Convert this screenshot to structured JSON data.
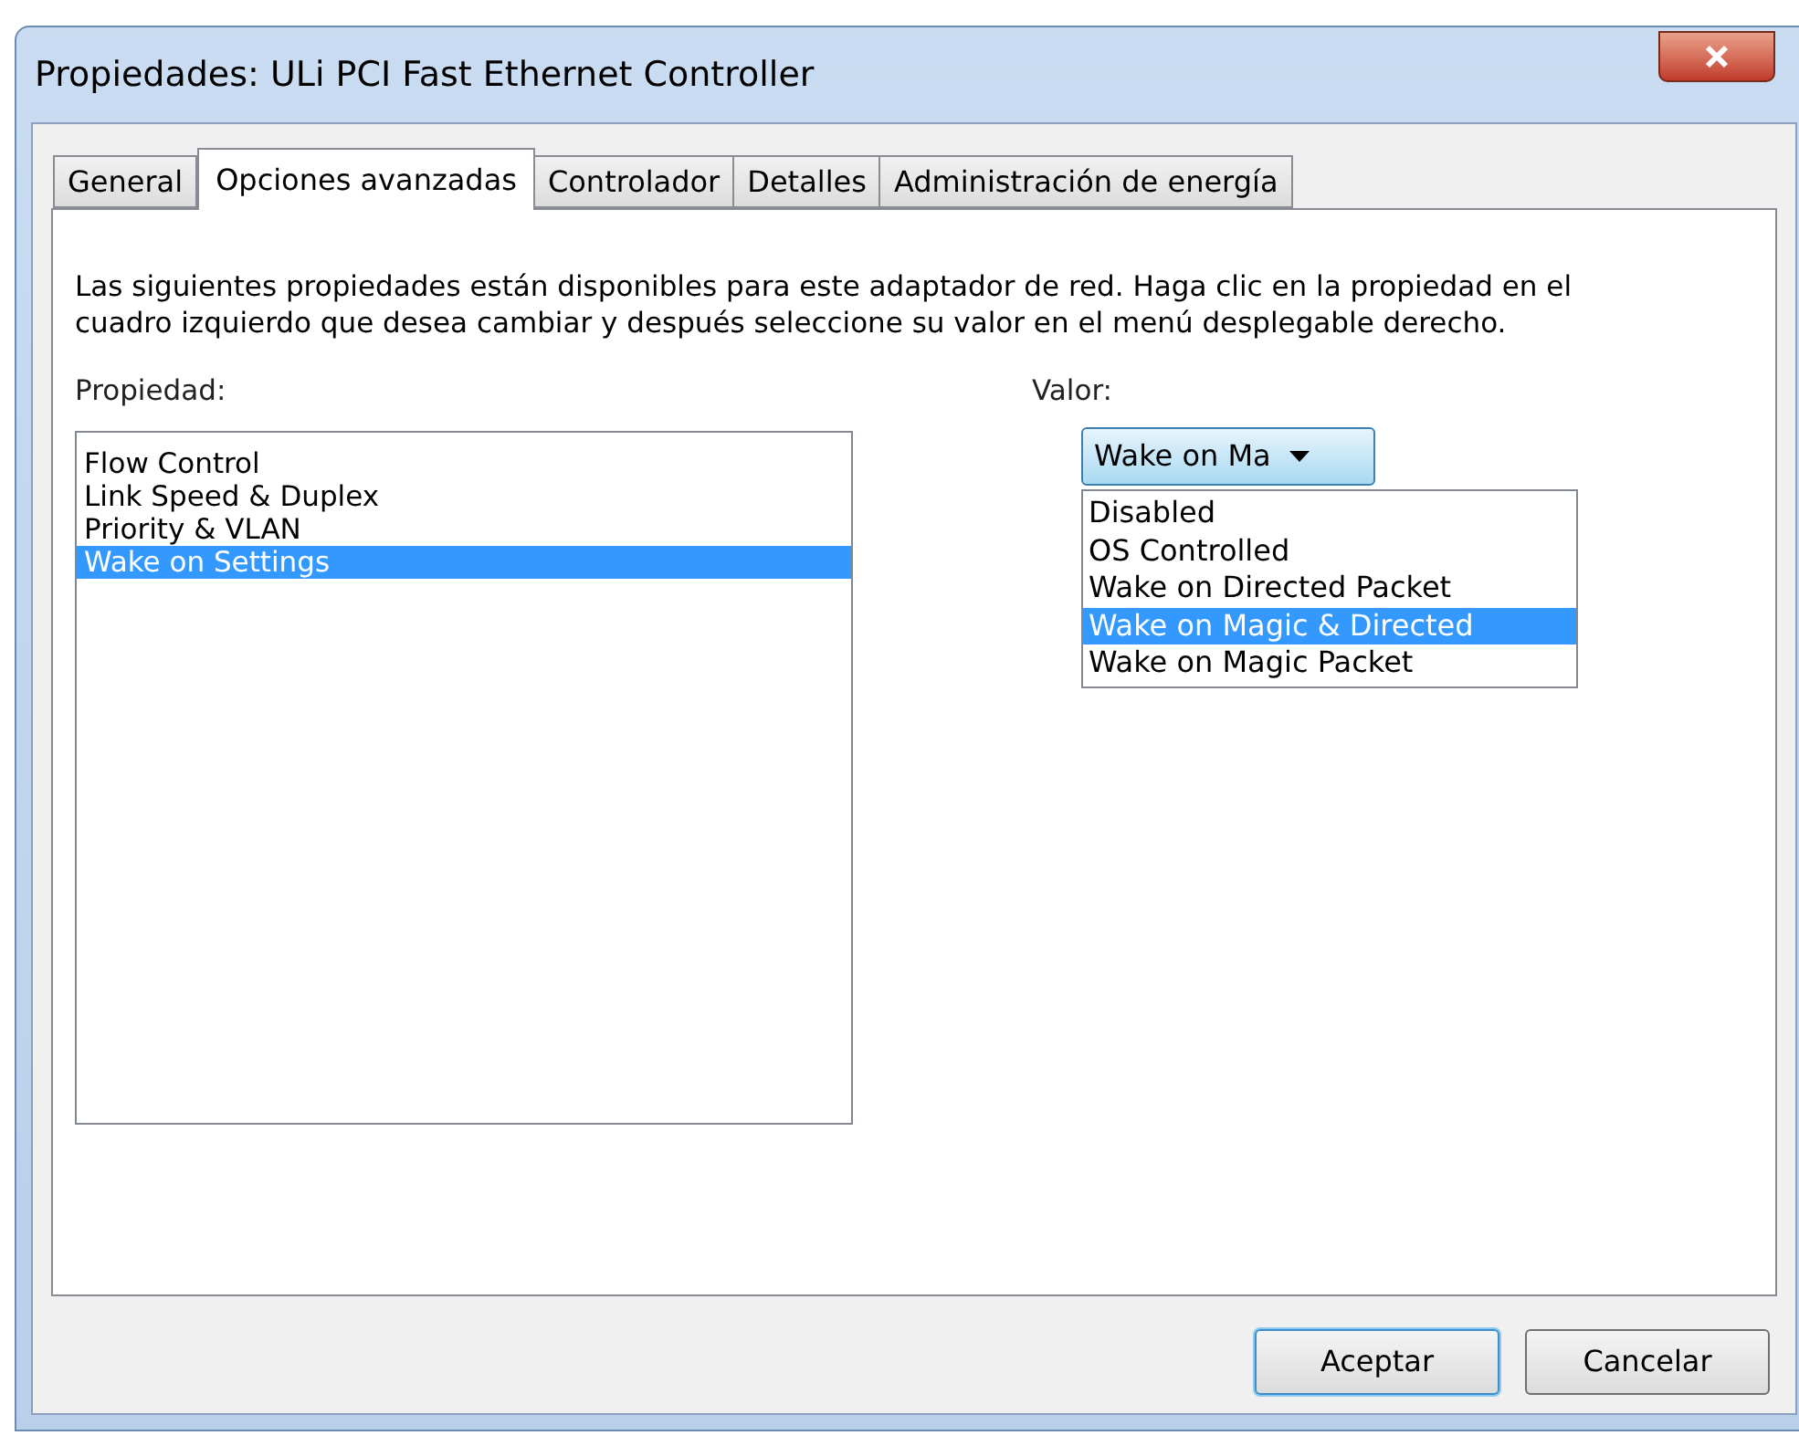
{
  "window": {
    "title": "Propiedades: ULi PCI Fast Ethernet Controller"
  },
  "tabs": [
    {
      "label": "General",
      "selected": false
    },
    {
      "label": "Opciones avanzadas",
      "selected": true
    },
    {
      "label": "Controlador",
      "selected": false
    },
    {
      "label": "Detalles",
      "selected": false
    },
    {
      "label": "Administración de energía",
      "selected": false
    }
  ],
  "description": "Las siguientes propiedades están disponibles para este adaptador de red. Haga clic en la propiedad en el cuadro izquierdo que desea cambiar y después seleccione su valor en el menú desplegable derecho.",
  "property": {
    "label": "Propiedad:",
    "items": [
      {
        "label": "Flow Control",
        "selected": false
      },
      {
        "label": "Link Speed & Duplex",
        "selected": false
      },
      {
        "label": "Priority & VLAN",
        "selected": false
      },
      {
        "label": "Wake on Settings",
        "selected": true
      }
    ]
  },
  "value": {
    "label": "Valor:",
    "combo_text": "Wake on Ma",
    "options": [
      {
        "label": "Disabled",
        "selected": false
      },
      {
        "label": "OS Controlled",
        "selected": false
      },
      {
        "label": "Wake on Directed Packet",
        "selected": false
      },
      {
        "label": "Wake on Magic & Directed",
        "selected": true
      },
      {
        "label": "Wake on Magic Packet",
        "selected": false
      }
    ]
  },
  "buttons": [
    {
      "label": "Aceptar",
      "default": true
    },
    {
      "label": "Cancelar",
      "default": false
    }
  ]
}
